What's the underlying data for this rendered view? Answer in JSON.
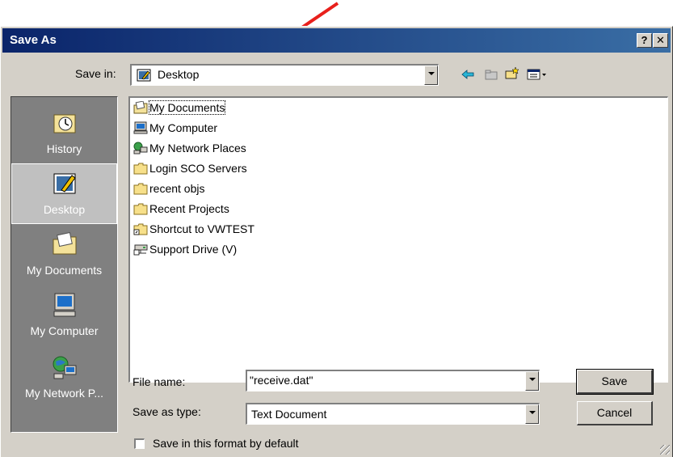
{
  "dialog": {
    "title": "Save As",
    "help_button": "?",
    "close_button": "✕"
  },
  "save_in": {
    "label": "Save in:",
    "value": "Desktop"
  },
  "places": [
    {
      "label": "History",
      "icon": "history-icon",
      "active": false
    },
    {
      "label": "Desktop",
      "icon": "desktop-icon",
      "active": true
    },
    {
      "label": "My Documents",
      "icon": "my-documents-icon",
      "active": false
    },
    {
      "label": "My Computer",
      "icon": "my-computer-icon",
      "active": false
    },
    {
      "label": "My Network P...",
      "icon": "network-places-icon",
      "active": false
    }
  ],
  "files": [
    {
      "name": "My Documents",
      "icon": "my-documents-icon"
    },
    {
      "name": "My Computer",
      "icon": "my-computer-icon"
    },
    {
      "name": "My Network Places",
      "icon": "network-places-icon"
    },
    {
      "name": "Login SCO Servers",
      "icon": "folder-icon"
    },
    {
      "name": "recent objs",
      "icon": "folder-icon"
    },
    {
      "name": "Recent Projects",
      "icon": "folder-icon"
    },
    {
      "name": "Shortcut to VWTEST",
      "icon": "folder-shortcut-icon"
    },
    {
      "name": "Support Drive (V)",
      "icon": "network-drive-icon"
    }
  ],
  "file_name": {
    "label": "File name:",
    "value": "\"receive.dat\""
  },
  "save_as_type": {
    "label": "Save as type:",
    "value": "Text Document"
  },
  "buttons": {
    "save": "Save",
    "cancel": "Cancel"
  },
  "default_checkbox": {
    "label": "Save in this format by default",
    "checked": false
  },
  "colors": {
    "title_bar": "#0a246a",
    "dialog_face": "#d4d0c8",
    "places_bar": "#808080",
    "annotation_arrow": "#e8201c"
  }
}
